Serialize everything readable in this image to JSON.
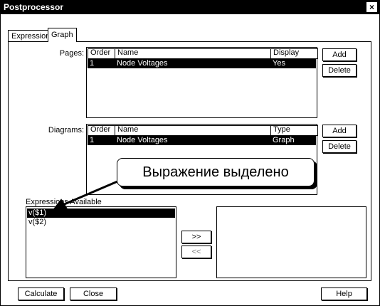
{
  "window": {
    "title": "Postprocessor",
    "close_glyph": "×"
  },
  "tabs": [
    {
      "label": "Expression",
      "active": false
    },
    {
      "label": "Graph",
      "active": true
    }
  ],
  "pages": {
    "label": "Pages:",
    "columns": [
      "Order",
      "Name",
      "Display"
    ],
    "rows": [
      {
        "order": "1",
        "name": "Node Voltages",
        "display": "Yes",
        "selected": true
      }
    ],
    "add_label": "Add",
    "delete_label": "Delete"
  },
  "diagrams": {
    "label": "Diagrams:",
    "columns": [
      "Order",
      "Name",
      "Type"
    ],
    "rows": [
      {
        "order": "1",
        "name": "Node Voltages",
        "type": "Graph",
        "selected": true
      }
    ],
    "add_label": "Add",
    "delete_label": "Delete"
  },
  "expressions": {
    "label": "Expressions Available",
    "items": [
      {
        "text": "v($1)",
        "selected": true
      },
      {
        "text": "v($2)",
        "selected": false
      }
    ],
    "move_right_label": ">>",
    "move_left_label": "<<"
  },
  "callout": {
    "text": "Выражение выделено"
  },
  "footer": {
    "calculate_label": "Calculate",
    "close_label": "Close",
    "help_label": "Help"
  }
}
